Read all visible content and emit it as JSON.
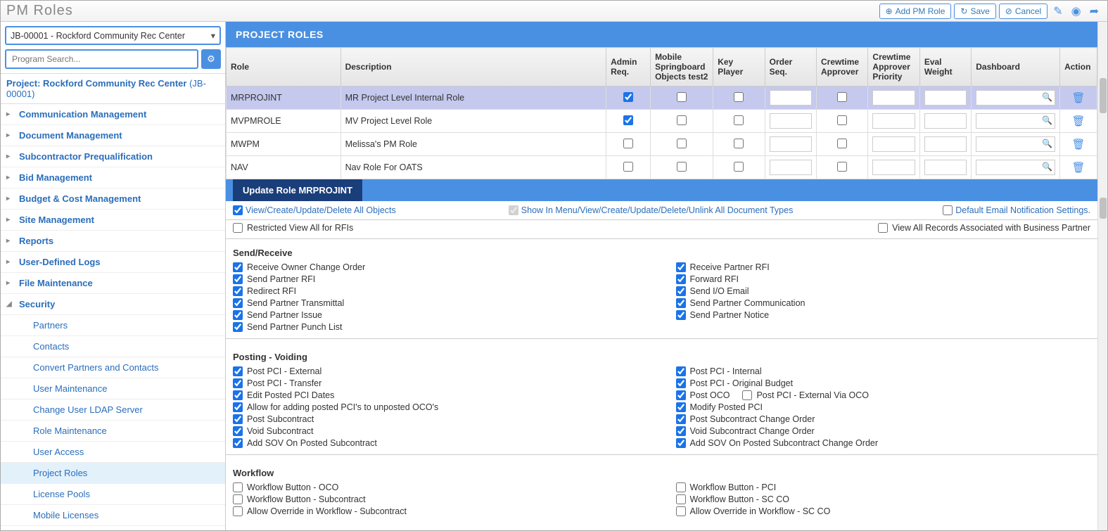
{
  "title": "PM Roles",
  "toolbar": {
    "add": "Add PM Role",
    "save": "Save",
    "cancel": "Cancel"
  },
  "sidebar": {
    "project_select": "JB-00001 - Rockford Community Rec Center",
    "search_placeholder": "Program Search...",
    "project_label": "Project: Rockford Community Rec Center",
    "project_code": "(JB-00001)",
    "items": [
      {
        "label": "Communication Management",
        "expanded": false
      },
      {
        "label": "Document Management",
        "expanded": false
      },
      {
        "label": "Subcontractor Prequalification",
        "expanded": false
      },
      {
        "label": "Bid Management",
        "expanded": false
      },
      {
        "label": "Budget & Cost Management",
        "expanded": false
      },
      {
        "label": "Site Management",
        "expanded": false
      },
      {
        "label": "Reports",
        "expanded": false
      },
      {
        "label": "User-Defined Logs",
        "expanded": false
      },
      {
        "label": "File Maintenance",
        "expanded": false
      },
      {
        "label": "Security",
        "expanded": true
      }
    ],
    "security_children": [
      "Partners",
      "Contacts",
      "Convert Partners and Contacts",
      "User Maintenance",
      "Change User LDAP Server",
      "Role Maintenance",
      "User Access",
      "Project Roles",
      "License Pools",
      "Mobile Licenses"
    ],
    "active_child": "Project Roles"
  },
  "panel_title": "PROJECT ROLES",
  "columns": [
    "Role",
    "Description",
    "Admin Req.",
    "Mobile Springboard Objects test2",
    "Key Player",
    "Order Seq.",
    "Crewtime Approver",
    "Crewtime Approver Priority",
    "Eval Weight",
    "Dashboard",
    "Action"
  ],
  "rows": [
    {
      "role": "MRPROJINT",
      "desc": "MR Project Level Internal Role",
      "admin": true,
      "mso": false,
      "kp": false,
      "ca": false,
      "selected": true
    },
    {
      "role": "MVPMROLE",
      "desc": "MV Project Level Role",
      "admin": true,
      "mso": false,
      "kp": false,
      "ca": false
    },
    {
      "role": "MWPM",
      "desc": "Melissa's PM Role",
      "admin": false,
      "mso": false,
      "kp": false,
      "ca": false
    },
    {
      "role": "NAV",
      "desc": "Nav Role For OATS",
      "admin": false,
      "mso": false,
      "kp": false,
      "ca": false
    }
  ],
  "update_title": "Update Role MRPROJINT",
  "top_options": {
    "view_objects": "View/Create/Update/Delete All Objects",
    "show_menu": "Show In Menu/View/Create/Update/Delete/Unlink All Document Types",
    "default_email": "Default Email Notification Settings.",
    "restricted": "Restricted View All for RFIs",
    "view_bp": "View All Records Associated with Business Partner"
  },
  "sections": [
    {
      "title": "Send/Receive",
      "left": [
        {
          "label": "Receive Owner Change Order",
          "checked": true
        },
        {
          "label": "Send Partner RFI",
          "checked": true
        },
        {
          "label": "Redirect RFI",
          "checked": true
        },
        {
          "label": "Send Partner Transmittal",
          "checked": true
        },
        {
          "label": "Send Partner Issue",
          "checked": true
        },
        {
          "label": "Send Partner Punch List",
          "checked": true
        }
      ],
      "right": [
        {
          "label": "Receive Partner RFI",
          "checked": true
        },
        {
          "label": "Forward RFI",
          "checked": true
        },
        {
          "label": "Send I/O Email",
          "checked": true
        },
        {
          "label": "Send Partner Communication",
          "checked": true
        },
        {
          "label": "Send Partner Notice",
          "checked": true
        }
      ]
    },
    {
      "title": "Posting - Voiding",
      "left": [
        {
          "label": "Post PCI - External",
          "checked": true
        },
        {
          "label": "Post PCI - Transfer",
          "checked": true
        },
        {
          "label": "Edit Posted PCI Dates",
          "checked": true
        },
        {
          "label": "Allow for adding posted PCI's to unposted OCO's",
          "checked": true
        },
        {
          "label": "Post Subcontract",
          "checked": true
        },
        {
          "label": "Void Subcontract",
          "checked": true
        },
        {
          "label": "Add SOV On Posted Subcontract",
          "checked": true
        }
      ],
      "right": [
        {
          "label": "Post PCI - Internal",
          "checked": true
        },
        {
          "label": "Post PCI - Original Budget",
          "checked": true
        },
        {
          "label": "Post OCO",
          "checked": true,
          "extra": {
            "label": "Post PCI - External Via OCO",
            "checked": false
          }
        },
        {
          "label": "Modify Posted PCI",
          "checked": true
        },
        {
          "label": "Post Subcontract Change Order",
          "checked": true
        },
        {
          "label": "Void Subcontract Change Order",
          "checked": true
        },
        {
          "label": "Add SOV On Posted Subcontract Change Order",
          "checked": true
        }
      ]
    },
    {
      "title": "Workflow",
      "left": [
        {
          "label": "Workflow Button - OCO",
          "checked": false
        },
        {
          "label": "Workflow Button - Subcontract",
          "checked": false
        },
        {
          "label": "Allow Override in Workflow - Subcontract",
          "checked": false
        }
      ],
      "right": [
        {
          "label": "Workflow Button - PCI",
          "checked": false
        },
        {
          "label": "Workflow Button - SC CO",
          "checked": false
        },
        {
          "label": "Allow Override in Workflow - SC CO",
          "checked": false
        }
      ]
    }
  ]
}
